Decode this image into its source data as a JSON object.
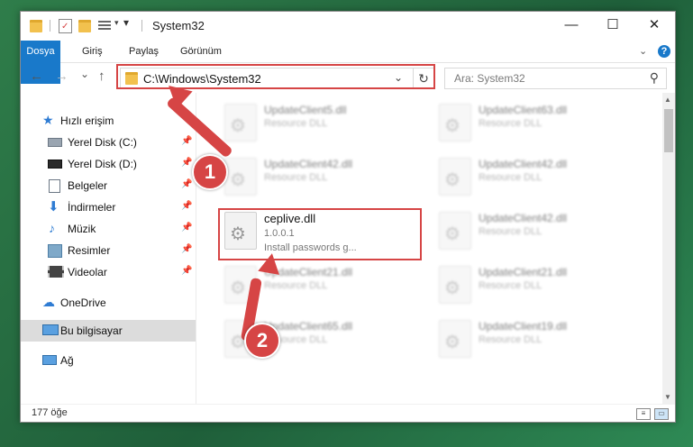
{
  "window": {
    "title": "System32",
    "controls": {
      "minimize": "—",
      "maximize": "☐",
      "close": "✕"
    }
  },
  "ribbon": {
    "tabs": [
      "Dosya",
      "Giriş",
      "Paylaş",
      "Görünüm"
    ],
    "expand_icon": "chevron-down-icon",
    "help": "?"
  },
  "nav": {
    "back": "←",
    "forward": "→",
    "recent": "⌄",
    "up": "↑",
    "address": "C:\\Windows\\System32",
    "dropdown": "⌄",
    "refresh": "↻",
    "search_placeholder": "Ara: System32",
    "search_icon": "⚲"
  },
  "sidebar": {
    "items": [
      {
        "label": "Hızlı erişim",
        "icon": "star-icon"
      },
      {
        "label": "Yerel Disk (C:)",
        "icon": "drive-icon",
        "pinned": true
      },
      {
        "label": "Yerel Disk (D:)",
        "icon": "drive-icon",
        "pinned": true
      },
      {
        "label": "Belgeler",
        "icon": "document-icon",
        "pinned": true
      },
      {
        "label": "İndirmeler",
        "icon": "download-icon",
        "pinned": true
      },
      {
        "label": "Müzik",
        "icon": "music-icon",
        "pinned": true
      },
      {
        "label": "Resimler",
        "icon": "pictures-icon",
        "pinned": true
      },
      {
        "label": "Videolar",
        "icon": "video-icon",
        "pinned": true
      },
      {
        "label": "OneDrive",
        "icon": "cloud-icon"
      },
      {
        "label": "Bu bilgisayar",
        "icon": "computer-icon",
        "selected": true
      },
      {
        "label": "Ağ",
        "icon": "network-icon"
      }
    ],
    "pin_glyph": "📌"
  },
  "files": [
    {
      "name": "UpdateClient5.dll",
      "line2": "Resource DLL",
      "line3": ""
    },
    {
      "name": "UpdateClient63.dll",
      "line2": "Resource DLL",
      "line3": ""
    },
    {
      "name": "UpdateClient42.dll",
      "line2": "Resource DLL",
      "line3": ""
    },
    {
      "name": "UpdateClient42.dll",
      "line2": "Resource DLL",
      "line3": ""
    },
    {
      "name": "ceplive.dll",
      "line2": "1.0.0.1",
      "line3": "Install passwords g..."
    },
    {
      "name": "UpdateClient42.dll",
      "line2": "Resource DLL",
      "line3": ""
    },
    {
      "name": "UpdateClient21.dll",
      "line2": "Resource DLL",
      "line3": ""
    },
    {
      "name": "UpdateClient21.dll",
      "line2": "Resource DLL",
      "line3": ""
    },
    {
      "name": "UpdateClient65.dll",
      "line2": "Resource DLL",
      "line3": ""
    },
    {
      "name": "UpdateClient19.dll",
      "line2": "Resource DLL",
      "line3": ""
    }
  ],
  "status": {
    "count": "177 öğe"
  },
  "annotations": {
    "step1": "1",
    "step2": "2",
    "color": "#d64545"
  }
}
